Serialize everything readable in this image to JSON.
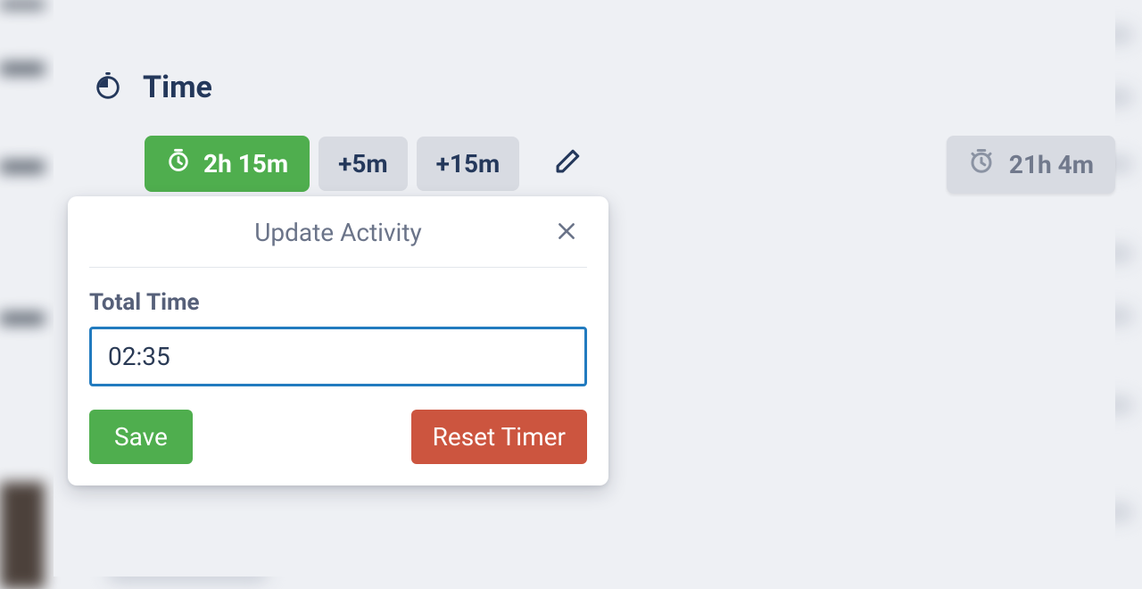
{
  "section": {
    "title": "Time"
  },
  "timer": {
    "current": "2h 15m",
    "add5": "+5m",
    "add15": "+15m",
    "total": "21h 4m"
  },
  "popover": {
    "title": "Update Activity",
    "field_label": "Total Time",
    "value": "02:35",
    "save": "Save",
    "reset": "Reset Timer"
  }
}
